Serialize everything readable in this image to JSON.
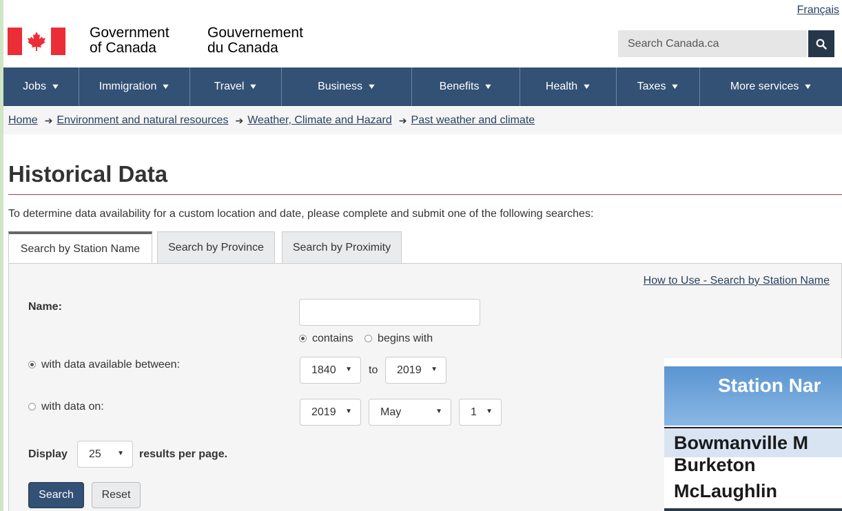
{
  "header": {
    "language_link": "Français",
    "gov_en_line1": "Government",
    "gov_en_line2": "of Canada",
    "gov_fr_line1": "Gouvernement",
    "gov_fr_line2": "du Canada",
    "search_placeholder": "Search Canada.ca"
  },
  "nav": {
    "items": [
      {
        "label": "Jobs"
      },
      {
        "label": "Immigration"
      },
      {
        "label": "Travel"
      },
      {
        "label": "Business"
      },
      {
        "label": "Benefits"
      },
      {
        "label": "Health"
      },
      {
        "label": "Taxes"
      },
      {
        "label": "More services"
      }
    ]
  },
  "breadcrumb": [
    "Home",
    "Environment and natural resources",
    "Weather, Climate and Hazard",
    "Past weather and climate"
  ],
  "page": {
    "title": "Historical Data",
    "intro": "To determine data availability for a custom location and date, please complete and submit one of the following searches:"
  },
  "tabs": [
    {
      "label": "Search by Station Name",
      "active": true
    },
    {
      "label": "Search by Province",
      "active": false
    },
    {
      "label": "Search by Proximity",
      "active": false
    }
  ],
  "form": {
    "how_to_link": "How to Use - Search by Station Name",
    "name_label": "Name:",
    "name_value": "",
    "match_contains": "contains",
    "match_begins": "begins with",
    "match_selected": "contains",
    "range_label": "with data available between:",
    "range_from": "1840",
    "range_to_word": "to",
    "range_to": "2019",
    "on_label": "with data on:",
    "on_year": "2019",
    "on_month": "May",
    "on_day": "1",
    "display_label": "Display",
    "per_page": "25",
    "per_page_suffix": "results per page.",
    "search_button": "Search",
    "reset_button": "Reset"
  },
  "overlay": {
    "header": "Station Nar",
    "rows": [
      "Bowmanville M",
      "Burketon",
      "McLaughlin"
    ]
  },
  "colors": {
    "nav_bg": "#335075",
    "link": "#284162",
    "flag_red": "#eb2d37",
    "title_rule": "#af3c43"
  }
}
